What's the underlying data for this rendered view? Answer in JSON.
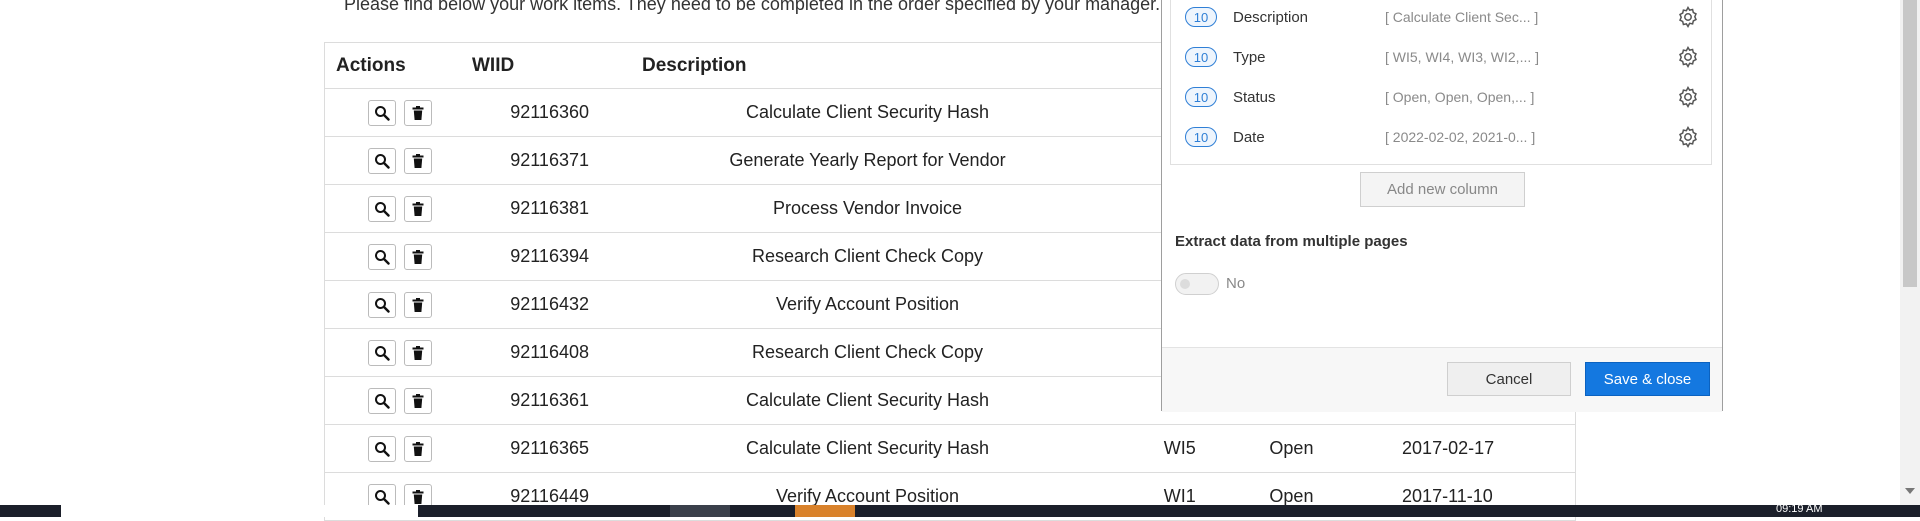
{
  "intro_text": "Please find below your work items. They need to be completed in the order specified by your manager.",
  "table": {
    "headers": {
      "actions": "Actions",
      "wiid": "WIID",
      "description": "Description"
    },
    "rows": [
      {
        "wiid": "92116360",
        "description": "Calculate Client Security Hash",
        "type": "",
        "status": "",
        "date": ""
      },
      {
        "wiid": "92116371",
        "description": "Generate Yearly Report for Vendor",
        "type": "",
        "status": "",
        "date": ""
      },
      {
        "wiid": "92116381",
        "description": "Process Vendor Invoice",
        "type": "",
        "status": "",
        "date": ""
      },
      {
        "wiid": "92116394",
        "description": "Research Client Check Copy",
        "type": "",
        "status": "",
        "date": ""
      },
      {
        "wiid": "92116432",
        "description": "Verify Account Position",
        "type": "",
        "status": "",
        "date": ""
      },
      {
        "wiid": "92116408",
        "description": "Research Client Check Copy",
        "type": "",
        "status": "",
        "date": ""
      },
      {
        "wiid": "92116361",
        "description": "Calculate Client Security Hash",
        "type": "",
        "status": "",
        "date": ""
      },
      {
        "wiid": "92116365",
        "description": "Calculate Client Security Hash",
        "type": "WI5",
        "status": "Open",
        "date": "2017-02-17"
      },
      {
        "wiid": "92116449",
        "description": "Verify Account Position",
        "type": "WI1",
        "status": "Open",
        "date": "2017-11-10"
      }
    ]
  },
  "panel": {
    "columns": [
      {
        "count": "10",
        "name": "Description",
        "values": "[ Calculate Client Sec...  ]"
      },
      {
        "count": "10",
        "name": "Type",
        "values": "[ WI5, WI4, WI3, WI2,...  ]"
      },
      {
        "count": "10",
        "name": "Status",
        "values": "[ Open, Open, Open,...  ]"
      },
      {
        "count": "10",
        "name": "Date",
        "values": "[ 2022-02-02, 2021-0...  ]"
      }
    ],
    "add_column_label": "Add new column",
    "extract_title": "Extract data from multiple pages",
    "toggle_label": "No",
    "cancel_label": "Cancel",
    "save_label": "Save & close"
  },
  "taskbar": {
    "clock": "09:19 AM"
  },
  "colors": {
    "primary": "#1478e0",
    "badge": "#2f7fd6"
  }
}
